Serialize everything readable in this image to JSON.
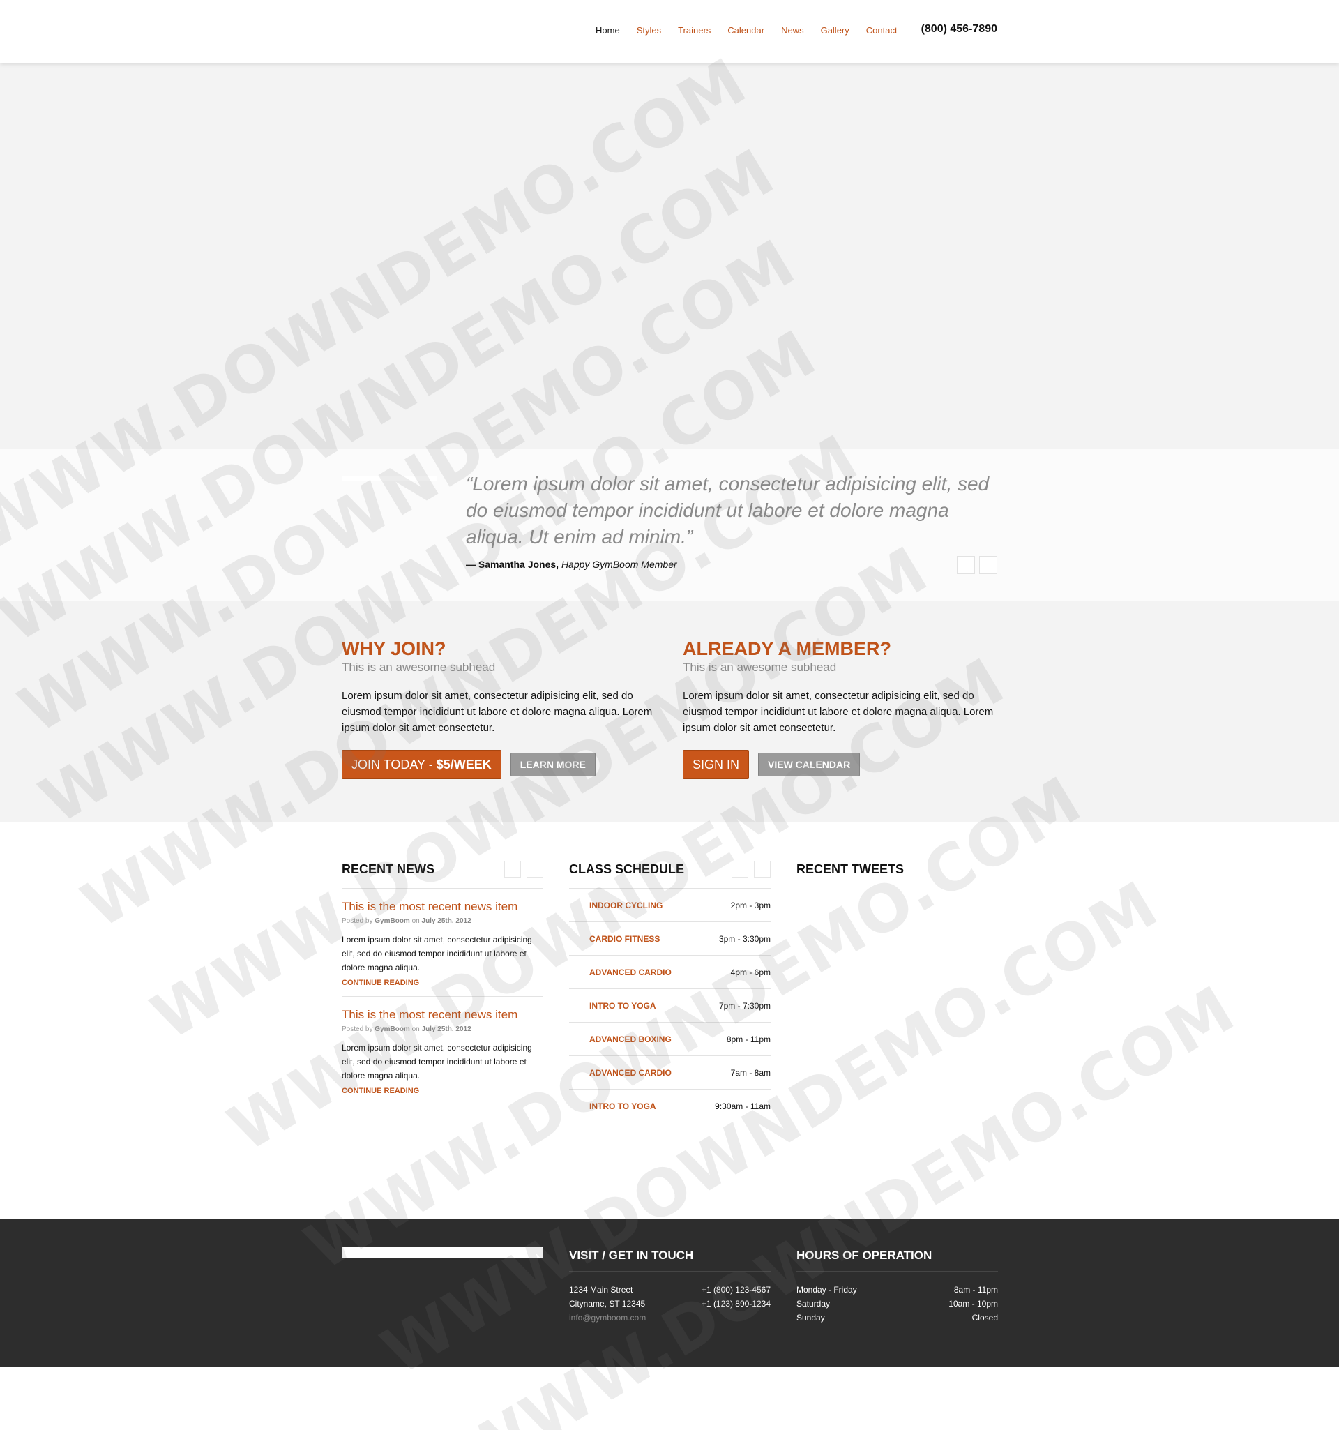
{
  "nav": {
    "items": [
      "Home",
      "Styles",
      "Trainers",
      "Calendar",
      "News",
      "Gallery",
      "Contact"
    ],
    "phone": "(800) 456-7890"
  },
  "testimonial": {
    "quote": "“Lorem ipsum dolor sit amet, consectetur adipisicing elit, sed do eiusmod tempor incididunt ut labore et dolore magna aliqua. Ut enim ad minim.”",
    "author": "— Samantha Jones,",
    "role": "Happy GymBoom Member"
  },
  "join": {
    "left": {
      "title": "WHY JOIN?",
      "subhead": "This is an awesome subhead",
      "body": "Lorem ipsum dolor sit amet, consectetur adipisicing elit, sed do eiusmod tempor incididunt ut labore et dolore magna aliqua. Lorem ipsum dolor sit amet consectetur.",
      "primary_label": "JOIN TODAY - ",
      "primary_price": "$5/WEEK",
      "secondary_label": "LEARN MORE"
    },
    "right": {
      "title": "ALREADY A MEMBER?",
      "subhead": "This is an awesome subhead",
      "body": "Lorem ipsum dolor sit amet, consectetur adipisicing elit, sed do eiusmod tempor incididunt ut labore et dolore magna aliqua. Lorem ipsum dolor sit amet consectetur.",
      "primary_label": "SIGN IN",
      "secondary_label": "VIEW CALENDAR"
    }
  },
  "news": {
    "heading": "RECENT NEWS",
    "items": [
      {
        "title": "This is the most recent news item",
        "posted_by": "Posted by",
        "author": "GymBoom",
        "on": "on",
        "date": "July 25th, 2012",
        "body": "Lorem ipsum dolor sit amet, consectetur adipisicing elit, sed do eiusmod tempor incididunt ut labore et dolore magna aliqua.",
        "more": "CONTINUE READING"
      },
      {
        "title": "This is the most recent news item",
        "posted_by": "Posted by",
        "author": "GymBoom",
        "on": "on",
        "date": "July 25th, 2012",
        "body": "Lorem ipsum dolor sit amet, consectetur adipisicing elit, sed do eiusmod tempor incididunt ut labore et dolore magna aliqua.",
        "more": "CONTINUE READING"
      }
    ]
  },
  "schedule": {
    "heading": "CLASS SCHEDULE",
    "rows": [
      {
        "name": "INDOOR CYCLING",
        "time": "2pm - 3pm"
      },
      {
        "name": "CARDIO FITNESS",
        "time": "3pm - 3:30pm"
      },
      {
        "name": "ADVANCED CARDIO",
        "time": "4pm - 6pm"
      },
      {
        "name": "INTRO TO YOGA",
        "time": "7pm - 7:30pm"
      },
      {
        "name": "ADVANCED BOXING",
        "time": "8pm - 11pm"
      },
      {
        "name": "ADVANCED CARDIO",
        "time": "7am - 8am"
      },
      {
        "name": "INTRO TO YOGA",
        "time": "9:30am - 11am"
      }
    ]
  },
  "tweets": {
    "heading": "RECENT TWEETS"
  },
  "footer": {
    "contact": {
      "heading": "VISIT / GET IN TOUCH",
      "address1": "1234 Main Street",
      "phone1": "+1 (800) 123-4567",
      "address2": "Cityname, ST 12345",
      "phone2": "+1 (123) 890-1234",
      "email": "info@gymboom.com"
    },
    "hours": {
      "heading": "HOURS OF OPERATION",
      "rows": [
        {
          "day": "Monday - Friday",
          "time": "8am - 11pm"
        },
        {
          "day": "Saturday",
          "time": "10am - 10pm"
        },
        {
          "day": "Sunday",
          "time": "Closed"
        }
      ]
    }
  },
  "watermark": "WWW.DOWNDEMO.COM"
}
